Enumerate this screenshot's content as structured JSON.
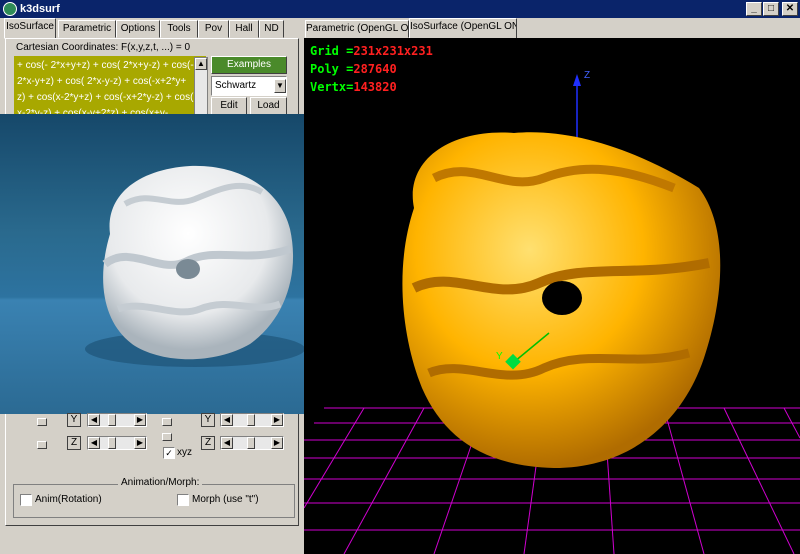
{
  "window": {
    "title": "k3dsurf",
    "min": "_",
    "max": "□",
    "close": "✕"
  },
  "tabs_left": [
    "IsoSurface",
    "Parametric",
    "Options",
    "Tools",
    "Pov",
    "Hall",
    "ND"
  ],
  "tabs_right": [
    "Parametric (OpenGL ON)",
    "IsoSurface (OpenGL ON)"
  ],
  "equation": {
    "label": "Cartesian Coordinates: F(x,y,z,t, ...) = 0",
    "lines": [
      "+ cos(- 2*x+y+z) + cos( 2*x+y-z) + cos(-",
      "2*x-y+z) + cos( 2*x-y-z) + cos(-x+2*y+",
      "z) + cos(x-2*y+z) + cos(-x+2*y-z) + cos(",
      "x-2*y-z) + cos(x-y+2*z) + cos(x+y-"
    ]
  },
  "examples": {
    "button": "Examples",
    "selected": "Schwartz",
    "edit": "Edit",
    "load": "Load"
  },
  "hud": {
    "grid_key": "Grid =",
    "grid_val": "231x231x231",
    "poly_key": "Poly =",
    "poly_val": "287640",
    "vertx_key": "Vertx=",
    "vertx_val": "143820"
  },
  "axes": {
    "z": "Z",
    "y": "Y"
  },
  "controls": {
    "y": "Y",
    "z": "Z",
    "xyz": "xyz",
    "xyz_checked": "✓"
  },
  "animation": {
    "title": "Animation/Morph:",
    "anim": "Anim(Rotation)",
    "morph": "Morph (use \"t\")"
  },
  "colors": {
    "surface": "#ffb000",
    "code_bg": "#a8a800",
    "examples_bg": "#4a8a2a",
    "grid": "#d000d0"
  }
}
